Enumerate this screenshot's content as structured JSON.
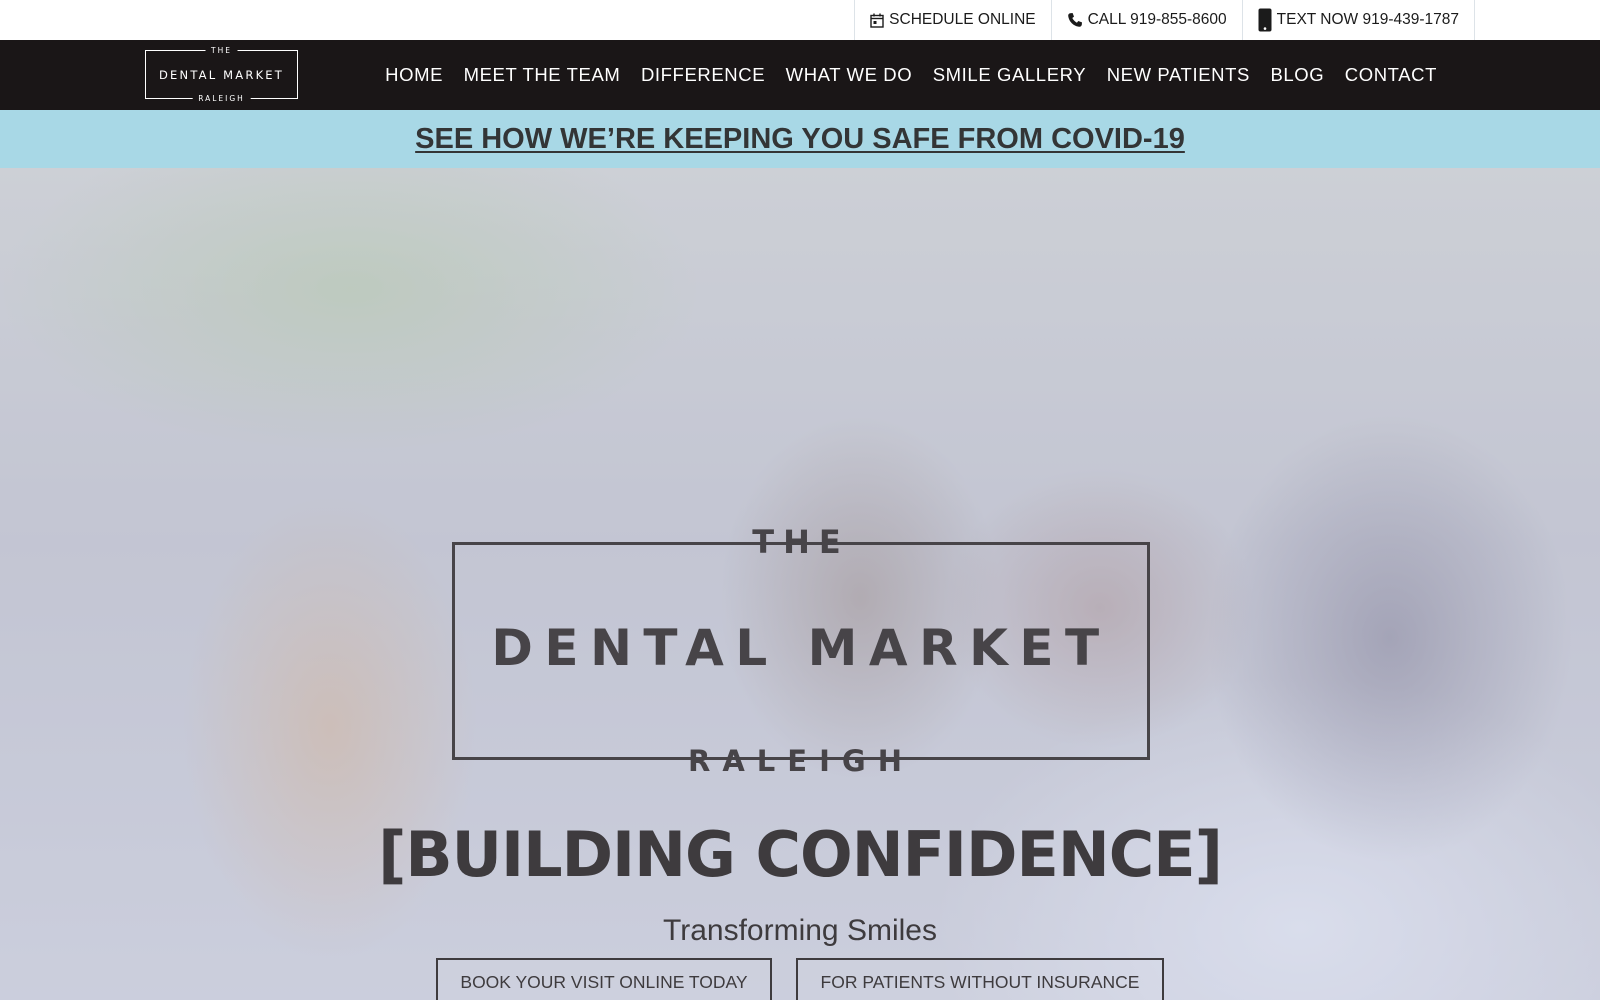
{
  "topbar": {
    "links": [
      {
        "icon": "calendar-icon",
        "label": "SCHEDULE ONLINE"
      },
      {
        "icon": "phone-icon",
        "label": "CALL 919-855-8600"
      },
      {
        "icon": "mobile-phone-icon",
        "label": "TEXT NOW 919-439-1787"
      }
    ]
  },
  "logo": {
    "top": "THE",
    "main": "DENTAL MARKET",
    "bottom": "RALEIGH"
  },
  "nav": {
    "items": [
      "HOME",
      "MEET THE TEAM",
      "DIFFERENCE",
      "WHAT WE DO",
      "SMILE GALLERY",
      "NEW PATIENTS",
      "BLOG",
      "CONTACT"
    ]
  },
  "banner": {
    "label": "SEE HOW WE’RE KEEPING YOU SAFE FROM COVID-19",
    "bg_color": "#a8d8e6"
  },
  "hero": {
    "logo": {
      "top": "THE",
      "main": "DENTAL MARKET",
      "bottom": "RALEIGH"
    },
    "title": "[BUILDING CONFIDENCE]",
    "subtitle": "Transforming Smiles",
    "buttons": {
      "book": "BOOK YOUR VISIT ONLINE TODAY",
      "insurance": "FOR PATIENTS WITHOUT INSURANCE"
    }
  },
  "colors": {
    "nav_bg": "#1a1617",
    "text_dark": "#3e3b3e"
  }
}
